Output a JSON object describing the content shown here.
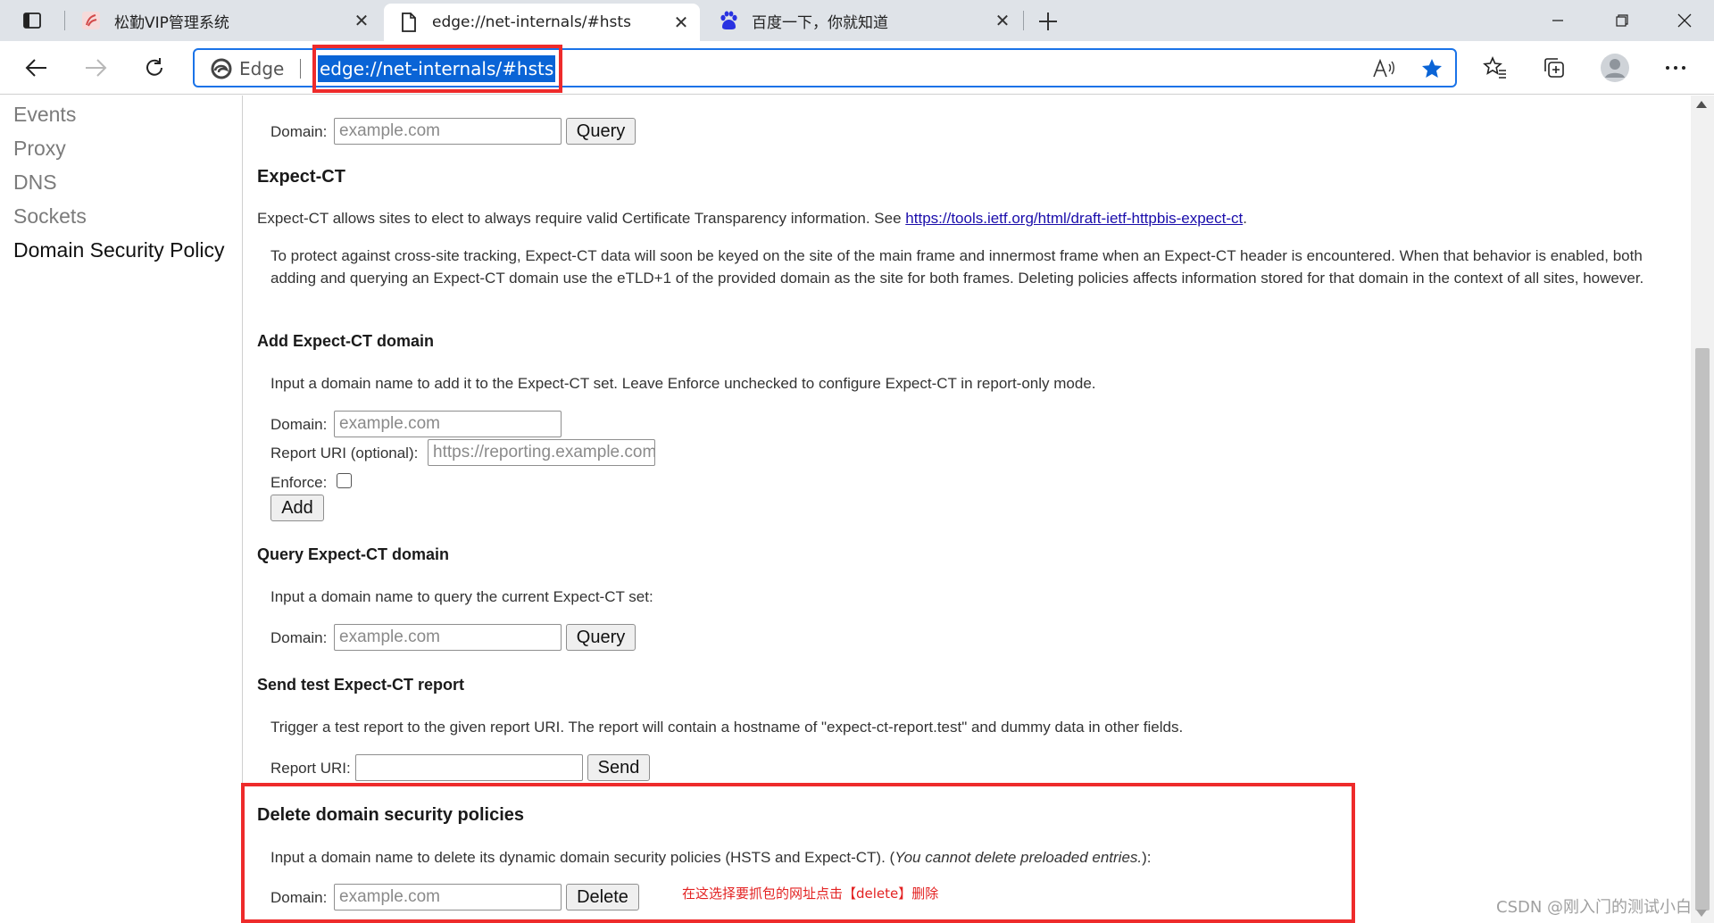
{
  "tabs": [
    {
      "title": "松勤VIP管理系统",
      "active": false
    },
    {
      "title": "edge://net-internals/#hsts",
      "active": true
    },
    {
      "title": "百度一下，你就知道",
      "active": false
    }
  ],
  "tab_close_glyph": "✕",
  "omnibox": {
    "chip_label": "Edge",
    "url": "edge://net-internals/#hsts"
  },
  "sidebar": {
    "items": [
      {
        "label": "Events",
        "active": false
      },
      {
        "label": "Proxy",
        "active": false
      },
      {
        "label": "DNS",
        "active": false
      },
      {
        "label": "Sockets",
        "active": false
      },
      {
        "label": "Domain Security Policy",
        "active": true
      }
    ]
  },
  "main": {
    "top_query": {
      "domain_label": "Domain:",
      "placeholder": "example.com",
      "button": "Query"
    },
    "expect_ct": {
      "heading": "Expect-CT",
      "intro": "Expect-CT allows sites to elect to always require valid Certificate Transparency information. See",
      "link": "https://tools.ietf.org/html/draft-ietf-httpbis-expect-ct",
      "intro_end": ".",
      "note": "To protect against cross-site tracking, Expect-CT data will soon be keyed on the site of the main frame and innermost frame when an Expect-CT header is encountered. When that behavior is enabled, both adding and querying an Expect-CT domain use the eTLD+1 of the provided domain as the site for both frames. Deleting policies affects information stored for that domain in the context of all sites, however."
    },
    "add_expect_ct": {
      "heading": "Add Expect-CT domain",
      "desc": "Input a domain name to add it to the Expect-CT set. Leave Enforce unchecked to configure Expect-CT in report-only mode.",
      "domain_label": "Domain:",
      "domain_placeholder": "example.com",
      "report_label": "Report URI (optional):",
      "report_placeholder": "https://reporting.example.com",
      "enforce_label": "Enforce:",
      "button": "Add"
    },
    "query_expect_ct": {
      "heading": "Query Expect-CT domain",
      "desc": "Input a domain name to query the current Expect-CT set:",
      "domain_label": "Domain:",
      "placeholder": "example.com",
      "button": "Query"
    },
    "send_test": {
      "heading": "Send test Expect-CT report",
      "desc": "Trigger a test report to the given report URI. The report will contain a hostname of \"expect-ct-report.test\" and dummy data in other fields.",
      "report_label": "Report URI:",
      "button": "Send"
    },
    "delete_policies": {
      "heading": "Delete domain security policies",
      "desc": "Input a domain name to delete its dynamic domain security policies (HSTS and Expect-CT). (",
      "desc_italic": "You cannot delete preloaded entries.",
      "desc_end": "):",
      "domain_label": "Domain:",
      "placeholder": "example.com",
      "button": "Delete"
    }
  },
  "annotation": "在这选择要抓包的网址点击【delete】删除",
  "watermark": "CSDN @刚入门的测试小白",
  "colors": {
    "accent": "#0a64d6",
    "annotation_red": "#ee2b2b",
    "link": "#1a0dab"
  }
}
